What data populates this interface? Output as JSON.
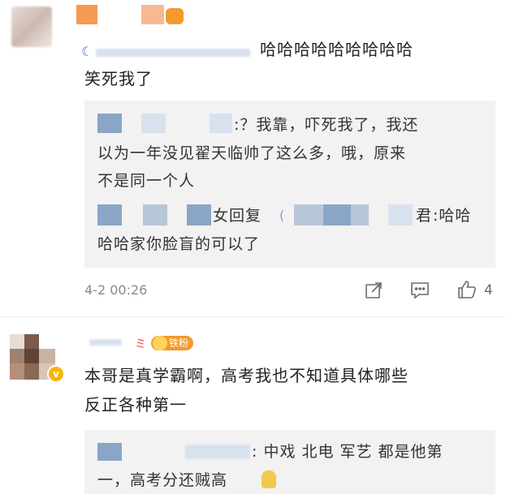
{
  "comment1": {
    "text_line1": "哈哈哈哈哈哈哈哈哈",
    "text_line2": "笑死我了",
    "replies": [
      {
        "text_a": ":？我靠，吓死我了，我还",
        "text_b": "以为一年没见翟天临帅了这么多，哦，原来",
        "text_c": "不是同一个人"
      },
      {
        "reply_word": "女回复",
        "name_tail": "君",
        "text_a": ":哈哈",
        "text_b": "哈哈家你脸盲的可以了"
      }
    ],
    "timestamp": "4-2 00:26",
    "like_count": "4",
    "icons": [
      "share-icon",
      "comment-icon",
      "like-icon"
    ]
  },
  "comment2": {
    "badge_label": "铁粉",
    "text_line1": "本哥是真学霸啊，高考我也不知道具体哪些",
    "text_line2": "反正各种第一",
    "reply": {
      "text_a": ": 中戏 北电 军艺 都是他第",
      "text_b": "一，高考分还贼高"
    }
  },
  "colors": {
    "accent_orange": "#f6a05a",
    "verified": "#f7b500",
    "badge_bg": "#f39a2e"
  }
}
